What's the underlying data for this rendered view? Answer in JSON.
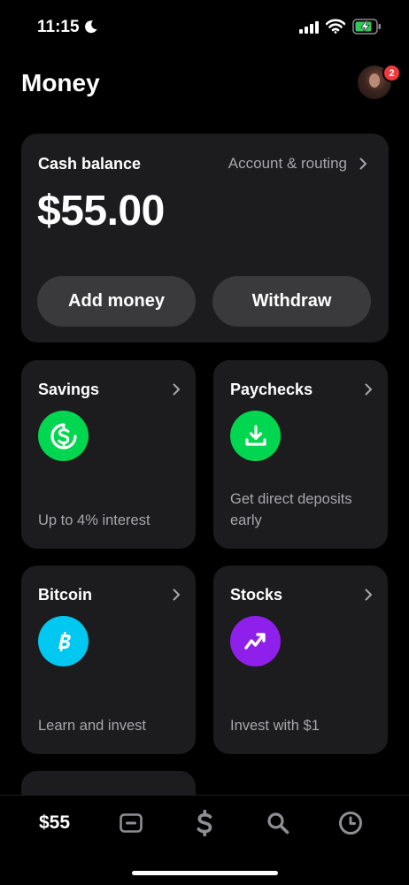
{
  "status_bar": {
    "time": "11:15"
  },
  "header": {
    "title": "Money",
    "notification_count": "2"
  },
  "cash_card": {
    "label": "Cash balance",
    "account_link": "Account & routing",
    "amount": "$55.00",
    "add_money_label": "Add money",
    "withdraw_label": "Withdraw"
  },
  "tiles": [
    {
      "title": "Savings",
      "subtitle": "Up to 4% interest",
      "icon": "savings-dollar-icon",
      "color": "#00d64f"
    },
    {
      "title": "Paychecks",
      "subtitle": "Get direct deposits early",
      "icon": "download-icon",
      "color": "#00d64f"
    },
    {
      "title": "Bitcoin",
      "subtitle": "Learn and invest",
      "icon": "bitcoin-icon",
      "color": "#00c8f0"
    },
    {
      "title": "Stocks",
      "subtitle": "Invest with $1",
      "icon": "stocks-trend-icon",
      "color": "#8f1fea"
    }
  ],
  "tab_bar": {
    "balance_label": "$55",
    "items": [
      "balance",
      "card-icon",
      "dollar-icon",
      "search-icon",
      "activity-clock-icon"
    ]
  },
  "colors": {
    "background": "#000000",
    "card": "#1c1c1e",
    "button": "#3a3a3c",
    "muted_text": "#a7a7ab",
    "badge": "#ee3b3b"
  }
}
